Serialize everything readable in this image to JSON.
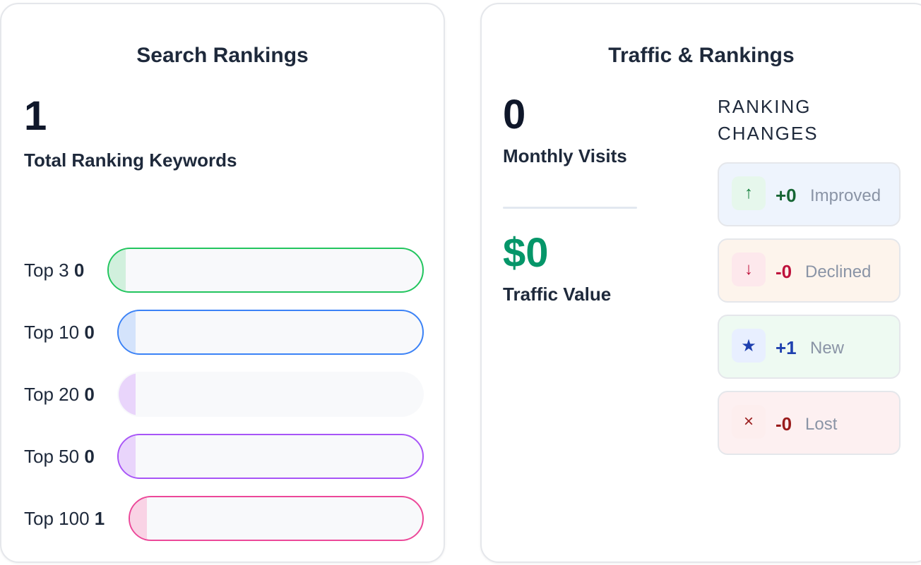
{
  "search_rankings": {
    "title": "Search Rankings",
    "total_keywords": "1",
    "total_keywords_label": "Total Ranking Keywords",
    "tiers": [
      {
        "label": "Top 3",
        "count": "0",
        "color": "#22c55e",
        "fill": "#d1f0dd",
        "outlined": true
      },
      {
        "label": "Top 10",
        "count": "0",
        "color": "#3b82f6",
        "fill": "#d4e3fb",
        "outlined": true
      },
      {
        "label": "Top 20",
        "count": "0",
        "color": "#a855f7",
        "fill": "#e9d5fb",
        "outlined": false
      },
      {
        "label": "Top 50",
        "count": "0",
        "color": "#a855f7",
        "fill": "#e9d5fb",
        "outlined": true
      },
      {
        "label": "Top 100",
        "count": "1",
        "color": "#ec4899",
        "fill": "#f9d3e5",
        "outlined": true
      }
    ]
  },
  "traffic_rankings": {
    "title": "Traffic & Rankings",
    "monthly_visits": "0",
    "monthly_visits_label": "Monthly Visits",
    "traffic_value": "$0",
    "traffic_value_label": "Traffic Value",
    "ranking_changes": {
      "heading": "RANKING CHANGES",
      "items": [
        {
          "icon": "arrow-up-icon",
          "glyph": "↑",
          "value": "+0",
          "label": "Improved",
          "value_color": "#166534",
          "icon_color": "#15803d",
          "icon_bg": "#e6f7ec",
          "bg": "#eef4fd"
        },
        {
          "icon": "arrow-down-icon",
          "glyph": "↓",
          "value": "-0",
          "label": "Declined",
          "value_color": "#be123c",
          "icon_color": "#be123c",
          "icon_bg": "#fde8ec",
          "bg": "#fdf4ec"
        },
        {
          "icon": "star-icon",
          "glyph": "★",
          "value": "+1",
          "label": "New",
          "value_color": "#1e40af",
          "icon_color": "#1e40af",
          "icon_bg": "#e8efff",
          "bg": "#eefaf2"
        },
        {
          "icon": "close-icon",
          "glyph": "×",
          "value": "-0",
          "label": "Lost",
          "value_color": "#991b1b",
          "icon_color": "#991b1b",
          "icon_bg": "#fdeeee",
          "bg": "#fdf0f1"
        }
      ]
    }
  }
}
